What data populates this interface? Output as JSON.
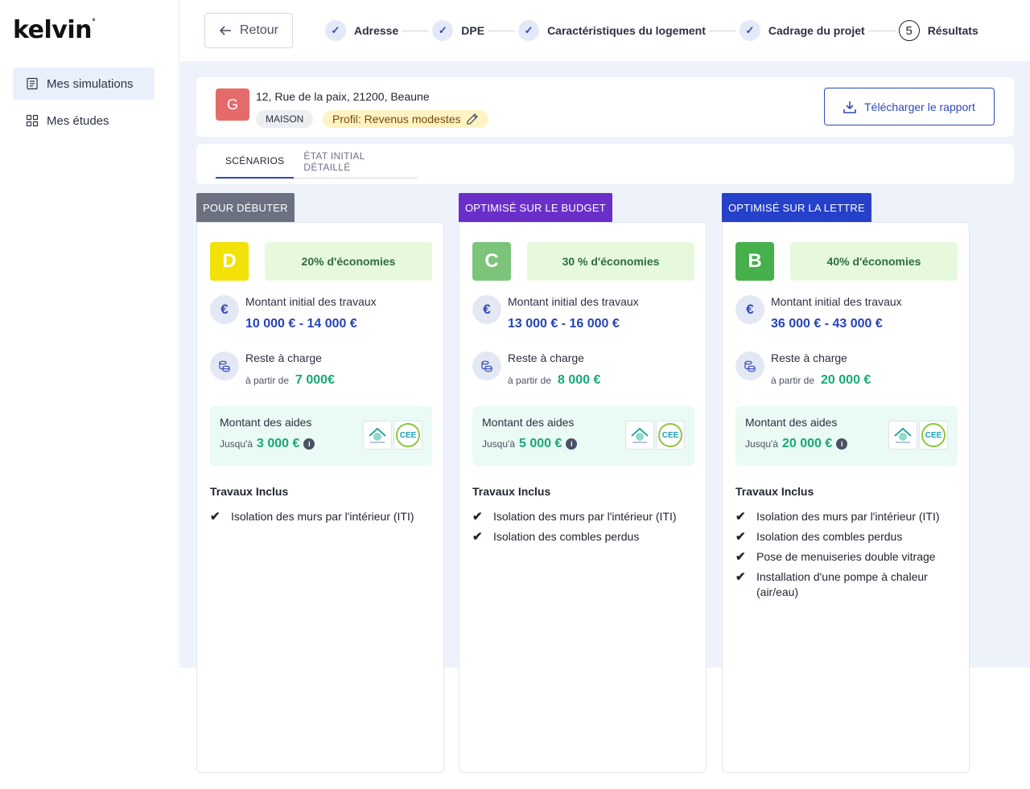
{
  "app": {
    "logo": "kelvin"
  },
  "sidebar": {
    "items": [
      {
        "label": "Mes simulations",
        "icon": "document-list-icon",
        "active": true
      },
      {
        "label": "Mes études",
        "icon": "grid-icon",
        "active": false
      }
    ]
  },
  "topbar": {
    "back_label": "Retour",
    "steps": [
      {
        "label": "Adresse",
        "done": true
      },
      {
        "label": "DPE",
        "done": true
      },
      {
        "label": "Caractéristiques du logement",
        "done": true
      },
      {
        "label": "Cadrage du projet",
        "done": true
      },
      {
        "label": "Résultats",
        "number": "5",
        "done": false
      }
    ]
  },
  "header": {
    "avatar_letter": "G",
    "avatar_color": "#e56a6a",
    "address": "12, Rue de la paix, 21200, Beaune",
    "house_tag": "MAISON",
    "profile_tag": "Profil: Revenus modestes",
    "download_label": "Télécharger le rapport"
  },
  "tabs": [
    {
      "label": "SCÉNARIOS",
      "active": true
    },
    {
      "label": "ÉTAT INITIAL DÉTAILLÉ",
      "active": false
    }
  ],
  "common": {
    "initial_amount_label": "Montant initial des travaux",
    "remaining_label": "Reste à charge",
    "from_label": "à partir de",
    "aids_label": "Montant des aides",
    "up_to_label": "Jusqu'à",
    "works_title": "Travaux Inclus",
    "cee_logo_text": "CEE"
  },
  "scenarios": [
    {
      "tag": "POUR DÉBUTER",
      "tag_color": "#6b7180",
      "dpe_letter": "D",
      "dpe_color": "#f2e207",
      "savings": "20% d'économies",
      "initial_amount": "10 000 € - 14 000 €",
      "remaining": "7 000€",
      "aids": "3 000 €",
      "works": [
        "Isolation des murs par l'intérieur (ITI)"
      ]
    },
    {
      "tag": "OPTIMISÉ SUR LE BUDGET",
      "tag_color": "#6b2fc9",
      "dpe_letter": "C",
      "dpe_color": "#7cc47a",
      "savings": "30 % d'économies",
      "initial_amount": "13 000 € - 16 000 €",
      "remaining": "8 000 €",
      "aids": "5 000 €",
      "works": [
        "Isolation des murs par l'intérieur (ITI)",
        "Isolation des combles perdus"
      ]
    },
    {
      "tag": "OPTIMISÉ SUR LA LETTRE",
      "tag_color": "#2540c9",
      "dpe_letter": "B",
      "dpe_color": "#46b04a",
      "savings": "40% d'économies",
      "initial_amount": "36 000 € - 43 000 €",
      "remaining": "20 000 €",
      "aids": "20 000 €",
      "works": [
        "Isolation des murs par l'intérieur (ITI)",
        "Isolation des combles perdus",
        "Pose de menuiseries double vitrage",
        "Installation d'une pompe à chaleur (air/eau)"
      ]
    }
  ]
}
